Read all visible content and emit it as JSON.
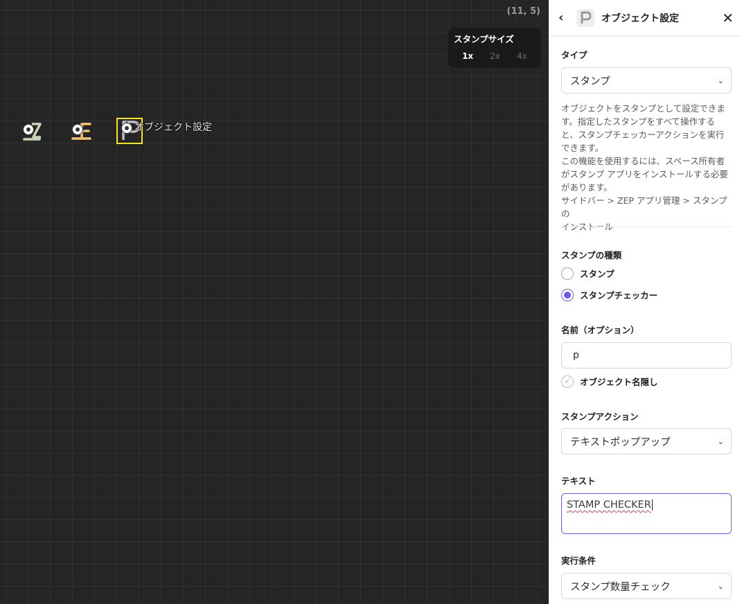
{
  "canvas": {
    "coords": "(11, 5)",
    "stamp_size": {
      "title": "スタンプサイズ",
      "options": [
        "1x",
        "2x",
        "4x"
      ],
      "selected": "1x"
    },
    "selected_object_label": "オブジェクト設定"
  },
  "panel": {
    "title": "オブジェクト設定",
    "type": {
      "label": "タイプ",
      "value": "スタンプ",
      "description": [
        "オブジェクトをスタンプとして設定できま",
        "す。指定したスタンプをすべて操作する",
        "と、スタンプチェッカーアクションを実行",
        "できます。",
        "この機能を使用するには、スペース所有者",
        "がスタンプ アプリをインストールする必要",
        "があります。",
        "サイドバー > ZEP アプリ管理 > スタンプの",
        "インストール"
      ]
    },
    "stamp_kind": {
      "label": "スタンプの種類",
      "options": [
        "スタンプ",
        "スタンプチェッカー"
      ],
      "selected": "スタンプチェッカー"
    },
    "name": {
      "label": "名前（オプション）",
      "value": "p",
      "hide_label": "オブジェクト名隠し"
    },
    "stamp_action": {
      "label": "スタンプアクション",
      "value": "テキストポップアップ"
    },
    "text": {
      "label": "テキスト",
      "value": "STAMP CHECKER"
    },
    "condition": {
      "label": "実行条件",
      "value": "スタンプ数量チェック"
    }
  }
}
